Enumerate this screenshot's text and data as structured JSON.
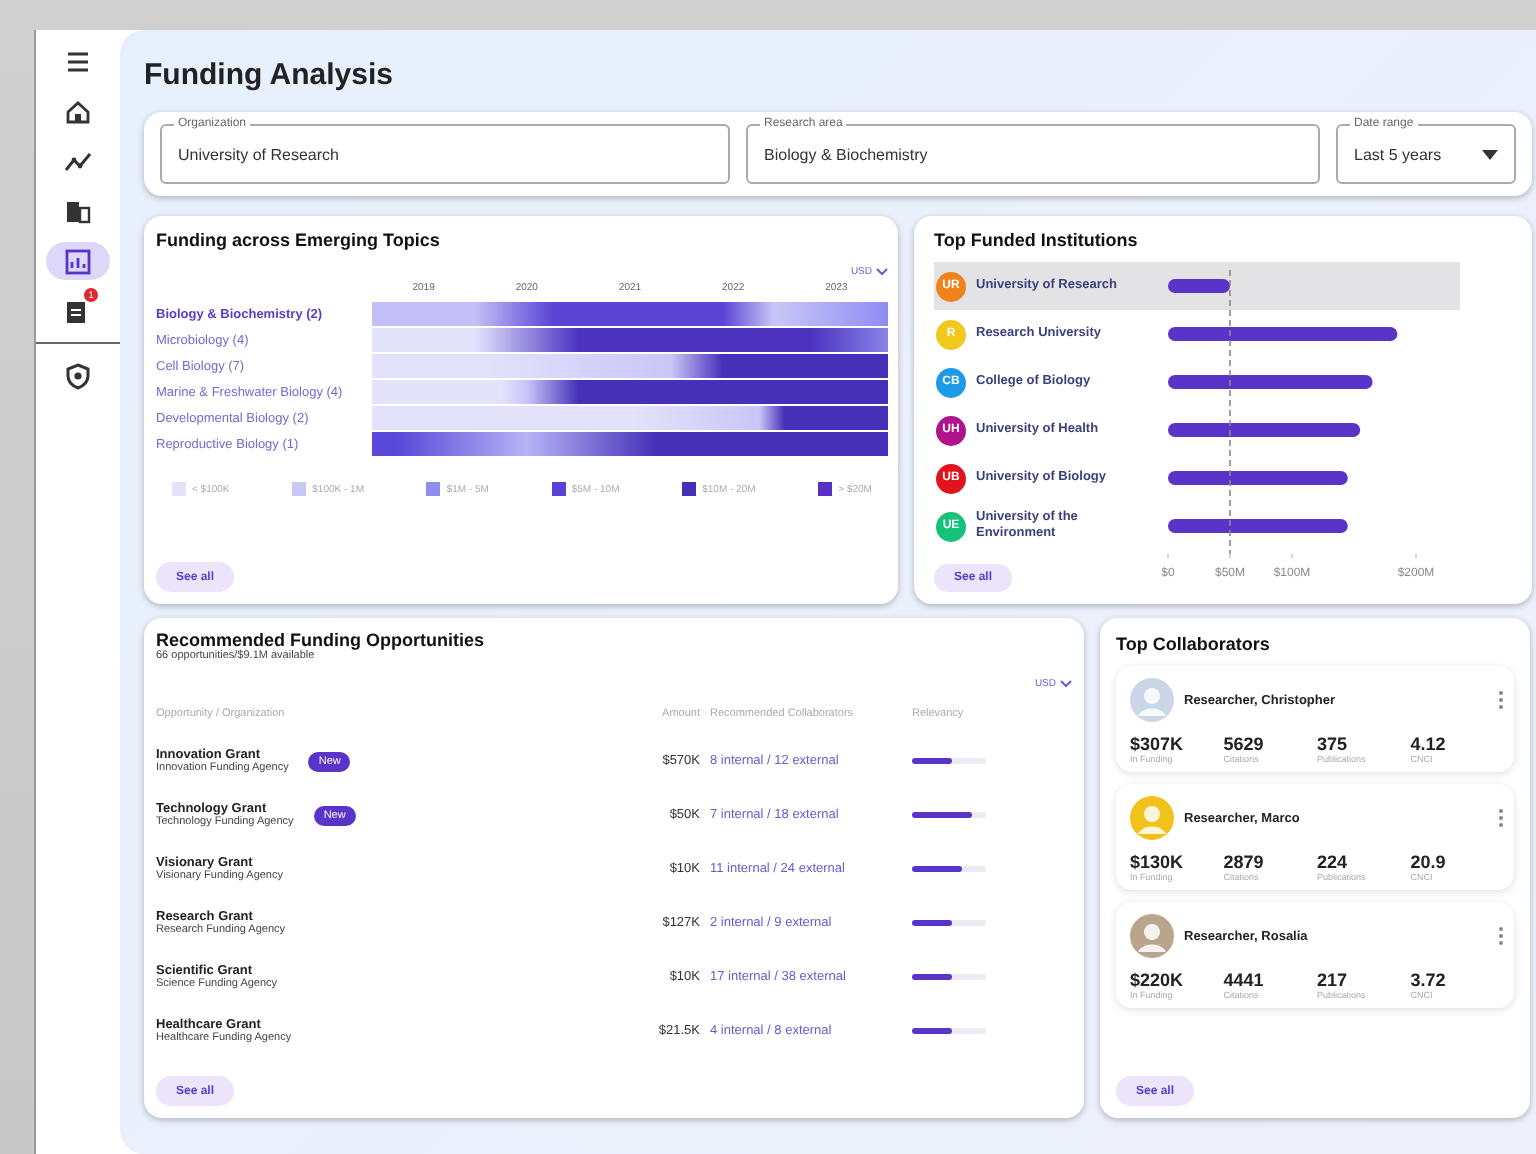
{
  "sidebar": {
    "items": [
      {
        "kind": "menu",
        "selected": false
      },
      {
        "kind": "home",
        "selected": false
      },
      {
        "kind": "trend",
        "selected": false
      },
      {
        "kind": "building",
        "selected": false
      },
      {
        "kind": "report",
        "selected": true
      },
      {
        "kind": "inbox",
        "selected": false,
        "badge": "1"
      },
      {
        "kind": "shield",
        "selected": false
      }
    ]
  },
  "page_title": "Funding Analysis",
  "filters": [
    {
      "kind": "text",
      "label": "Organization",
      "value": "University of Research"
    },
    {
      "kind": "text",
      "label": "Research area",
      "value": "Biology & Biochemistry"
    },
    {
      "kind": "select",
      "label": "Date range",
      "value": "Last 5 years"
    }
  ],
  "emerging_topics": {
    "title": "Funding across Emerging Topics",
    "currency": "USD",
    "years": [
      "2019",
      "2020",
      "2021",
      "2022",
      "2023"
    ],
    "topics": [
      {
        "label": "Biology & Biochemistry (2)",
        "selected": true
      },
      {
        "label": "Microbiology (4)",
        "selected": false
      },
      {
        "label": "Cell Biology (7)",
        "selected": false
      },
      {
        "label": "Marine & Freshwater Biology (4)",
        "selected": false
      },
      {
        "label": "Developmental Biology (2)",
        "selected": false
      },
      {
        "label": "Reproductive Biology (1)",
        "selected": false
      }
    ],
    "legend": [
      {
        "label": "< $100K",
        "color": "#e4e3fb"
      },
      {
        "label": "$100K - 1M",
        "color": "#c9c6f8"
      },
      {
        "label": "$1M - 5M",
        "color": "#8f8cf2"
      },
      {
        "label": "$5M - 10M",
        "color": "#5a40d6"
      },
      {
        "label": "$10M - 20M",
        "color": "#4630b8"
      },
      {
        "label": "> $20M",
        "color": "#5a2fc6"
      }
    ],
    "see_all": "See all"
  },
  "top_institutions": {
    "title": "Top Funded Institutions",
    "institutions": [
      {
        "logo": "UR",
        "color": "#f0821e",
        "selected": true
      },
      {
        "logo": "R",
        "color": "#f2c81c",
        "selected": false
      },
      {
        "logo": "CB",
        "color": "#1e9be8",
        "selected": false
      },
      {
        "logo": "UH",
        "color": "#b0148c",
        "selected": false
      },
      {
        "logo": "UB",
        "color": "#e0141e",
        "selected": false
      },
      {
        "logo": "UE",
        "color": "#16c27a",
        "selected": false
      }
    ],
    "chart_data": {
      "type": "bar",
      "orientation": "horizontal",
      "categories": [
        "University of Research",
        "Research University",
        "College of Biology",
        "University of Health",
        "University of Biology",
        "University of the Environment"
      ],
      "values": [
        50,
        185,
        165,
        155,
        145,
        145
      ],
      "xlim": [
        0,
        200
      ],
      "xticks": [
        {
          "value": 0,
          "label": "$0"
        },
        {
          "value": 50,
          "label": "$50M"
        },
        {
          "value": 100,
          "label": "$100M"
        },
        {
          "value": 200,
          "label": "$200M"
        }
      ]
    },
    "see_all": "See all"
  },
  "opportunities": {
    "title": "Recommended Funding Opportunities",
    "subtitle": "66 opportunities/$9.1M available",
    "currency": "USD",
    "columns": [
      "Opportunity / Organization",
      "Amount",
      "Recommended Collaborators",
      "Relevancy"
    ],
    "rows": [
      {
        "name": "Innovation Grant",
        "agency": "Innovation Funding Agency",
        "badge": "New",
        "amount": "$570K",
        "collaborators": "8 internal / 12 external",
        "level": 0.55
      },
      {
        "name": "Technology Grant",
        "agency": "Technology Funding Agency",
        "badge": "New",
        "amount": "$50K",
        "collaborators": "7 internal / 18 external",
        "level": 0.82
      },
      {
        "name": "Visionary Grant",
        "agency": "Visionary Funding Agency",
        "amount": "$10K",
        "collaborators": "11 internal / 24 external",
        "level": 0.68
      },
      {
        "name": "Research Grant",
        "agency": "Research Funding Agency",
        "amount": "$127K",
        "collaborators": "2 internal / 9 external",
        "level": 0.55
      },
      {
        "name": "Scientific Grant",
        "agency": "Science Funding Agency",
        "amount": "$10K",
        "collaborators": "17 internal / 38 external",
        "level": 0.55
      },
      {
        "name": "Healthcare Grant",
        "agency": "Healthcare Funding Agency",
        "amount": "$21.5K",
        "collaborators": "4 internal / 8 external",
        "level": 0.55
      }
    ],
    "see_all": "See all"
  },
  "collaborators": {
    "title": "Top Collaborators",
    "people": [
      {
        "name": "Researcher, Christopher",
        "stats": [
          {
            "value": "$307K",
            "label": "In Funding"
          },
          {
            "value": "5629",
            "label": "Citations"
          },
          {
            "value": "375",
            "label": "Publications"
          },
          {
            "value": "4.12",
            "label": "CNCI"
          }
        ]
      },
      {
        "name": "Researcher, Marco",
        "stats": [
          {
            "value": "$130K",
            "label": "In Funding"
          },
          {
            "value": "2879",
            "label": "Citations"
          },
          {
            "value": "224",
            "label": "Publications"
          },
          {
            "value": "20.9",
            "label": "CNCI"
          }
        ]
      },
      {
        "name": "Researcher, Rosalia",
        "stats": [
          {
            "value": "$220K",
            "label": "In Funding"
          },
          {
            "value": "4441",
            "label": "Citations"
          },
          {
            "value": "217",
            "label": "Publications"
          },
          {
            "value": "3.72",
            "label": "CNCI"
          }
        ]
      }
    ],
    "see_all": "See all"
  }
}
